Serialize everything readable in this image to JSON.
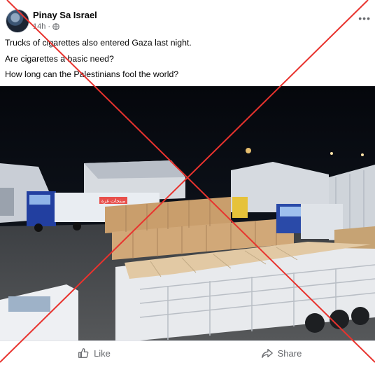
{
  "post": {
    "author": "Pinay Sa Israel",
    "time": "14h",
    "privacy_icon": "globe-icon",
    "more_label": "•••",
    "lines": [
      "Trucks of cigarettes also entered Gaza last night.",
      "Are cigarettes a basic need?",
      "How long can the Palestinians fool the world?"
    ],
    "photo_sign_text": "منتجات غزة"
  },
  "actions": {
    "like_label": "Like",
    "like_icon": "thumbs-up-icon",
    "share_label": "Share",
    "share_icon": "share-icon"
  },
  "overlay": {
    "color": "#e8332e",
    "icon": "red-x-mark"
  }
}
